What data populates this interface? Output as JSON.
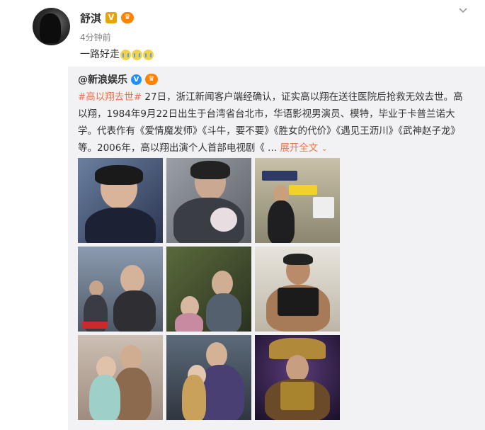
{
  "post": {
    "author_name": "舒淇",
    "badge_verified": "V",
    "badge_member": "♛",
    "time": "4分钟前",
    "text": "一路好走",
    "emoji": [
      "crying-emoji",
      "crying-emoji",
      "crying-emoji"
    ],
    "menu_icon": "chevron-down-icon"
  },
  "repost": {
    "author_name": "@新浪娱乐",
    "badge_verified": "V",
    "badge_member": "♛",
    "hashtag": "#高以翔去世#",
    "body": " 27日，浙江新闻客户端经确认，证实高以翔在送往医院后抢救无效去世。高以翔，1984年9月22日出生于台湾省台北市，华语影视男演员、模特，毕业于卡普兰诺大学。代表作有《爱情魔发师》《斗牛，要不要》《胜女的代价》《遇见王沥川》《武神赵子龙》等。2006年，高以翔出演个人首部电视剧《 ... ",
    "expand_label": "展开全文",
    "expand_icon": "chevron-down-icon",
    "photos": [
      "photo-1",
      "photo-2",
      "photo-3",
      "photo-4",
      "photo-5",
      "photo-6",
      "photo-7",
      "photo-8",
      "photo-9"
    ]
  },
  "colors": {
    "hashtag": "#eb7350",
    "repost_bg": "#f2f2f5",
    "verified_orange": "#e8a400",
    "verified_blue": "#1e90ff"
  }
}
